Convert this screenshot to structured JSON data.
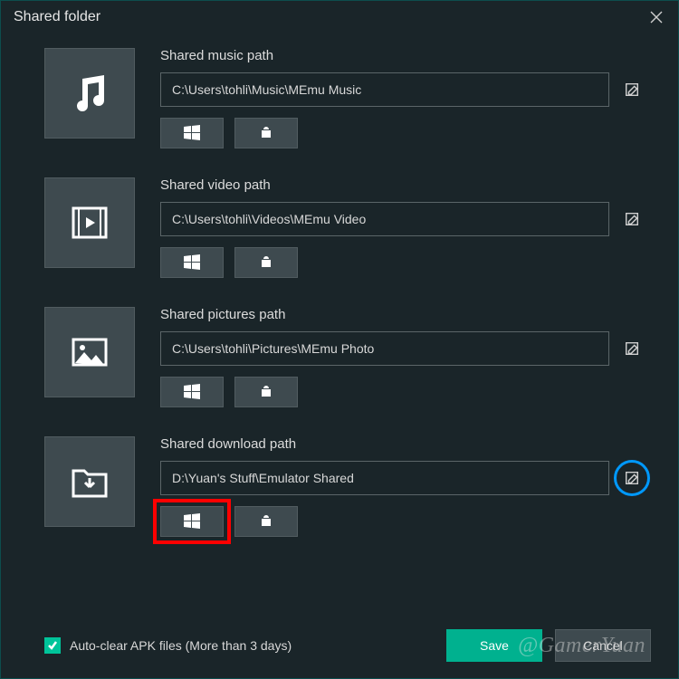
{
  "window": {
    "title": "Shared folder"
  },
  "rows": [
    {
      "icon": "music",
      "label": "Shared music path",
      "path": "C:\\Users\\tohli\\Music\\MEmu Music"
    },
    {
      "icon": "video",
      "label": "Shared video path",
      "path": "C:\\Users\\tohli\\Videos\\MEmu Video"
    },
    {
      "icon": "pictures",
      "label": "Shared pictures path",
      "path": "C:\\Users\\tohli\\Pictures\\MEmu Photo"
    },
    {
      "icon": "download",
      "label": "Shared download path",
      "path": "D:\\Yuan's Stuff\\Emulator Shared",
      "highlight_edit": true,
      "highlight_win": true
    }
  ],
  "auto_clear": {
    "checked": true,
    "label": "Auto-clear APK files (More than 3 days)"
  },
  "buttons": {
    "save": "Save",
    "cancel": "Cancel"
  },
  "watermark": "@GamerYuan",
  "colors": {
    "accent": "#00b18f",
    "annotate_blue": "#0099ff",
    "annotate_red": "#ff0000"
  }
}
